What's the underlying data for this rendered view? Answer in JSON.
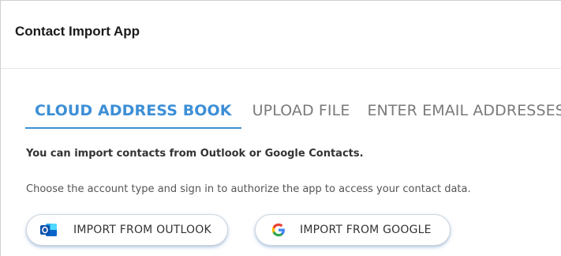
{
  "app": {
    "title": "Contact Import App"
  },
  "tabs": [
    {
      "label": "CLOUD ADDRESS BOOK",
      "active": true
    },
    {
      "label": "UPLOAD FILE",
      "active": false
    },
    {
      "label": "ENTER EMAIL ADDRESSES",
      "active": false
    }
  ],
  "content": {
    "intro": "You can import contacts from Outlook or Google Contacts.",
    "instructions": "Choose the account type and sign in to authorize the app to access your contact data."
  },
  "buttons": {
    "outlook": {
      "label": "IMPORT FROM OUTLOOK",
      "icon": "outlook-icon"
    },
    "google": {
      "label": "IMPORT FROM GOOGLE",
      "icon": "google-icon"
    }
  },
  "colors": {
    "accent": "#3d8fd6",
    "inactive_tab": "#7a7a7a",
    "text": "#333333",
    "outlook_blue": "#0a64c9"
  }
}
